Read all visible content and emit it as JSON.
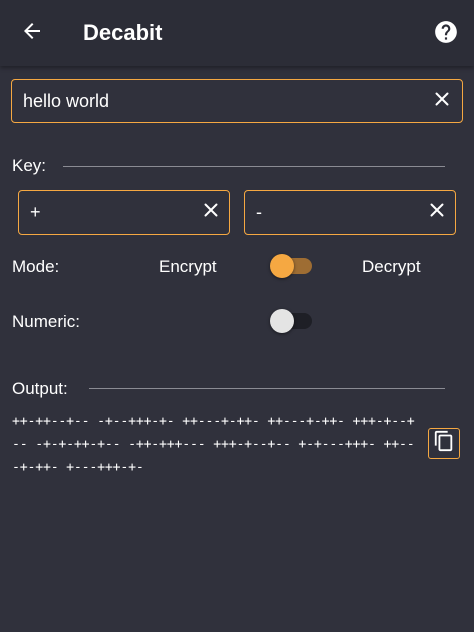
{
  "app": {
    "title": "Decabit"
  },
  "input": {
    "value": "hello world"
  },
  "key": {
    "label": "Key:",
    "plus_value": "+",
    "minus_value": "-"
  },
  "mode": {
    "label": "Mode:",
    "encrypt_label": "Encrypt",
    "decrypt_label": "Decrypt",
    "is_decrypt": true
  },
  "numeric": {
    "label": "Numeric:",
    "enabled": false
  },
  "output": {
    "label": "Output:",
    "text": "++-++--+-- -+--+++-+- ++---+-++- ++---+-++- +++-+--+-- -+-+-++-+-- -++-+++--- +++-+--+-- +-+---+++- ++---+-++- +---+++-+-"
  },
  "colors": {
    "accent": "#f5a842",
    "background": "#30313c",
    "appbar": "#2c2d37",
    "switch_on_thumb": "#f5a842",
    "switch_on_track": "#9e6d33",
    "switch_off_thumb": "#e4e4e4",
    "switch_off_track": "#1e1f26"
  }
}
